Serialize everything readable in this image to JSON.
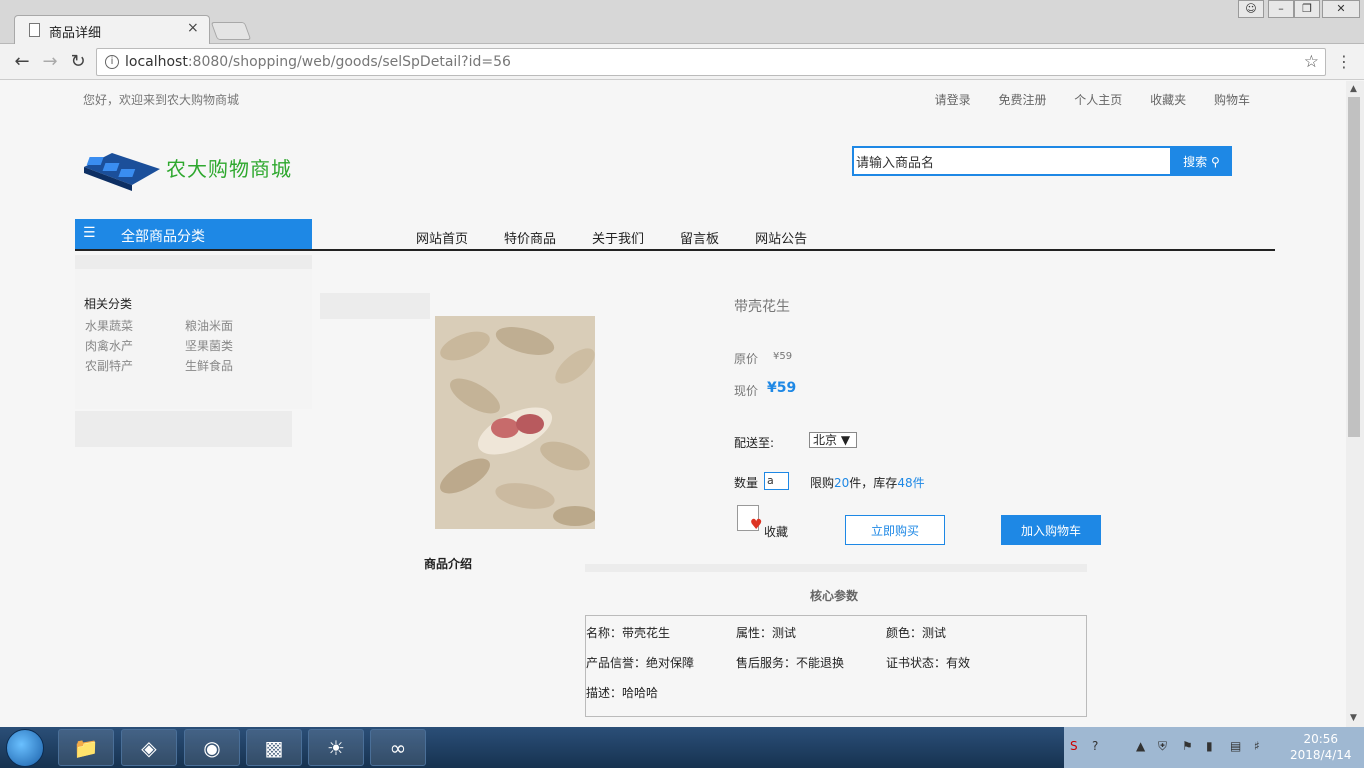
{
  "browser": {
    "tab_title": "商品详细",
    "tab_close": "×",
    "url_host": "localhost",
    "url_rest": ":8080/shopping/web/goods/selSpDetail?id=56"
  },
  "topbar": {
    "greeting": "您好，欢迎来到农大购物商城",
    "links": [
      "请登录",
      "免费注册",
      "个人主页",
      "收藏夹",
      "购物车"
    ]
  },
  "logo_text": "农大购物商城",
  "search": {
    "value": "请输入商品名",
    "button": "搜索"
  },
  "category_bar": "全部商品分类",
  "nav": [
    "网站首页",
    "特价商品",
    "关于我们",
    "留言板",
    "网站公告"
  ],
  "sidebar": {
    "title": "相关分类",
    "items": [
      "水果蔬菜",
      "粮油米面",
      "肉禽水产",
      "坚果菌类",
      "农副特产",
      "生鲜食品"
    ]
  },
  "product": {
    "name": "带壳花生",
    "original_label": "原价",
    "original_price": "¥59",
    "current_label": "现价",
    "current_price": "¥59",
    "ship_label": "配送至:",
    "ship_value": "北京",
    "qty_label": "数量",
    "qty_value": "a",
    "limit_prefix": "限购",
    "limit_num": "20",
    "limit_mid": "件，库存",
    "stock_num": "48件",
    "fav_label": "收藏",
    "buy_now": "立即购买",
    "add_cart": "加入购物车"
  },
  "intro_title": "商品介绍",
  "params": {
    "title": "核心参数",
    "items": [
      "名称：带壳花生",
      "属性：测试",
      "颜色：测试",
      "产品信誉：绝对保障",
      "售后服务：不能退换",
      "证书状态：有效",
      "描述：哈哈哈"
    ]
  },
  "taskbar": {
    "time": "20:56",
    "date": "2018/4/14"
  }
}
